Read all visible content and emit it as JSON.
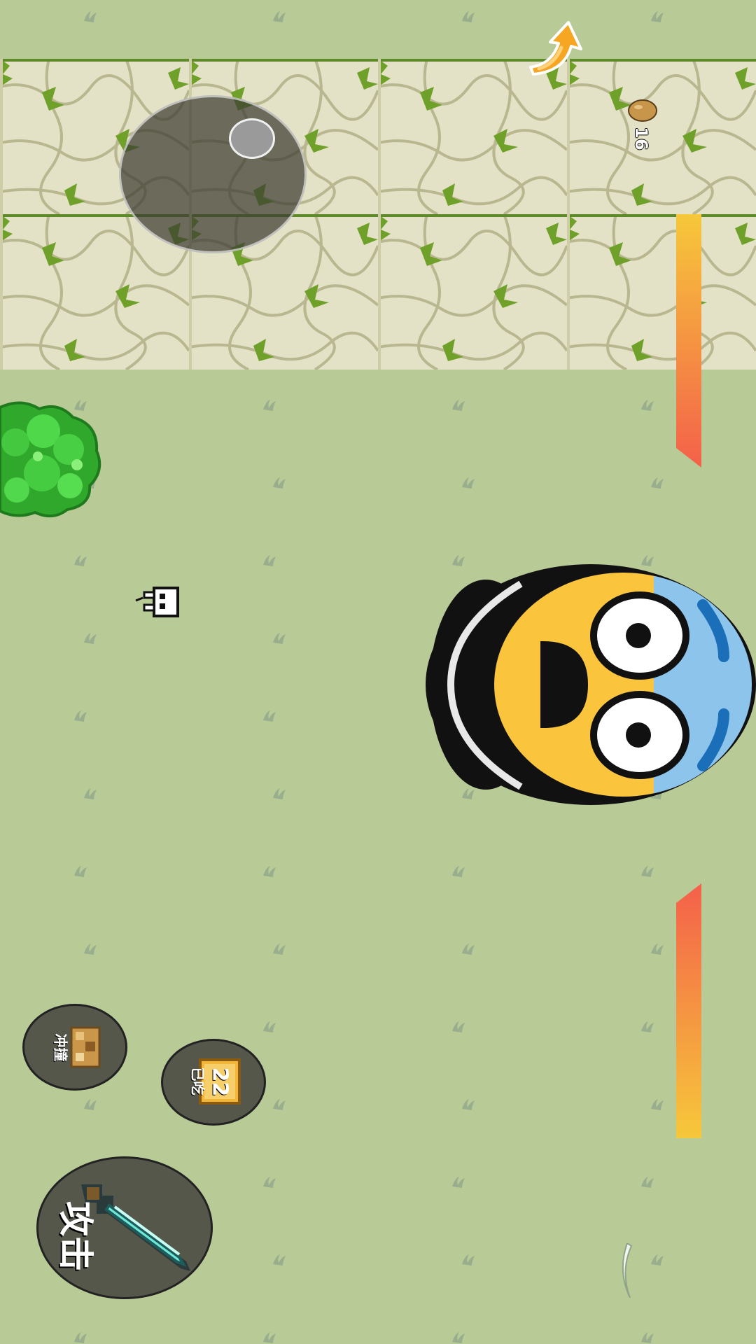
{
  "hud": {
    "seed_count": "16",
    "health_bar_color_top": "#f6c83a",
    "health_bar_color_bottom": "#f4604a"
  },
  "buttons": {
    "dash_label": "冲撞",
    "potion_label": "已吃",
    "potion_badge": "22",
    "attack_label": "攻击"
  },
  "colors": {
    "grass": "#b8ca96",
    "stone": "#e2e0c2",
    "moss": "#6fa12a",
    "button_bg": "#55574a",
    "bush": "#3cc83a"
  },
  "icons": {
    "back": "orange-curved-arrow-icon",
    "seed": "seed-icon",
    "joystick": "virtual-joystick",
    "enemy": "scared-emoji-face",
    "player": "small-pixel-character",
    "bush": "green-bush",
    "dash": "dash-skill-icon",
    "potion": "potion-skill-icon",
    "attack": "diamond-sword-icon"
  }
}
